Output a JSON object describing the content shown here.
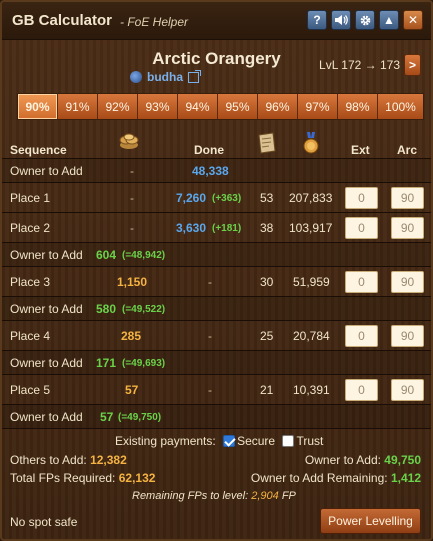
{
  "titlebar": {
    "title": "GB Calculator",
    "subtitle": "- FoE Helper",
    "buttons": [
      "help-icon",
      "sound-icon",
      "gear-icon",
      "minimize-icon",
      "close-icon"
    ],
    "help_glyph": "?",
    "up_glyph": "▲",
    "close_glyph": "✕"
  },
  "header": {
    "building": "Arctic Orangery",
    "player": "budha",
    "level": "LvL 172 → 173",
    "next_glyph": ">"
  },
  "percent_tabs": [
    "90%",
    "91%",
    "92%",
    "93%",
    "94%",
    "95%",
    "96%",
    "97%",
    "98%",
    "100%"
  ],
  "selected_percent": "90%",
  "columns": {
    "sequence": "Sequence",
    "done": "Done",
    "ext": "Ext",
    "arc": "Arc"
  },
  "rows": [
    {
      "kind": "owner",
      "label": "Owner to Add",
      "fp": "-",
      "done": "48,338"
    },
    {
      "kind": "place",
      "label": "Place 1",
      "fp": "-",
      "done": "7,260",
      "done_extra": "(+363)",
      "bp": "53",
      "medals": "207,833",
      "ext": "0",
      "arc": "90"
    },
    {
      "kind": "place",
      "label": "Place 2",
      "fp": "-",
      "done": "3,630",
      "done_extra": "(+181)",
      "bp": "38",
      "medals": "103,917",
      "ext": "0",
      "arc": "90"
    },
    {
      "kind": "owner",
      "label": "Owner to Add",
      "fp": "604",
      "fp_extra": "(=48,942)"
    },
    {
      "kind": "place",
      "label": "Place 3",
      "fp": "1,150",
      "done": "-",
      "bp": "30",
      "medals": "51,959",
      "ext": "0",
      "arc": "90"
    },
    {
      "kind": "owner",
      "label": "Owner to Add",
      "fp": "580",
      "fp_extra": "(=49,522)"
    },
    {
      "kind": "place",
      "label": "Place 4",
      "fp": "285",
      "done": "-",
      "bp": "25",
      "medals": "20,784",
      "ext": "0",
      "arc": "90"
    },
    {
      "kind": "owner",
      "label": "Owner to Add",
      "fp": "171",
      "fp_extra": "(=49,693)"
    },
    {
      "kind": "place",
      "label": "Place 5",
      "fp": "57",
      "done": "-",
      "bp": "21",
      "medals": "10,391",
      "ext": "0",
      "arc": "90"
    },
    {
      "kind": "owner",
      "label": "Owner to Add",
      "fp": "57",
      "fp_extra": "(=49,750)"
    }
  ],
  "footer": {
    "existing_payments": "Existing payments:",
    "secure": "Secure",
    "secure_checked": true,
    "trust": "Trust",
    "trust_checked": false,
    "others_label": "Others to Add:",
    "others_value": "12,382",
    "owner_label": "Owner to Add:",
    "owner_value": "49,750",
    "total_label": "Total FPs Required:",
    "total_value": "62,132",
    "remaining_owner_label": "Owner to Add Remaining:",
    "remaining_owner_value": "1,412",
    "remaining_fps_label": "Remaining FPs to level:",
    "remaining_fps_value": "2,904",
    "fp_unit": "FP",
    "spot_status": "No spot safe",
    "power_levelling": "Power Levelling"
  },
  "colors": {
    "accent_orange": "#d8773c",
    "blue_value": "#5aa7ee",
    "green_value": "#6ad24a",
    "fp_orange": "#f5b342"
  }
}
